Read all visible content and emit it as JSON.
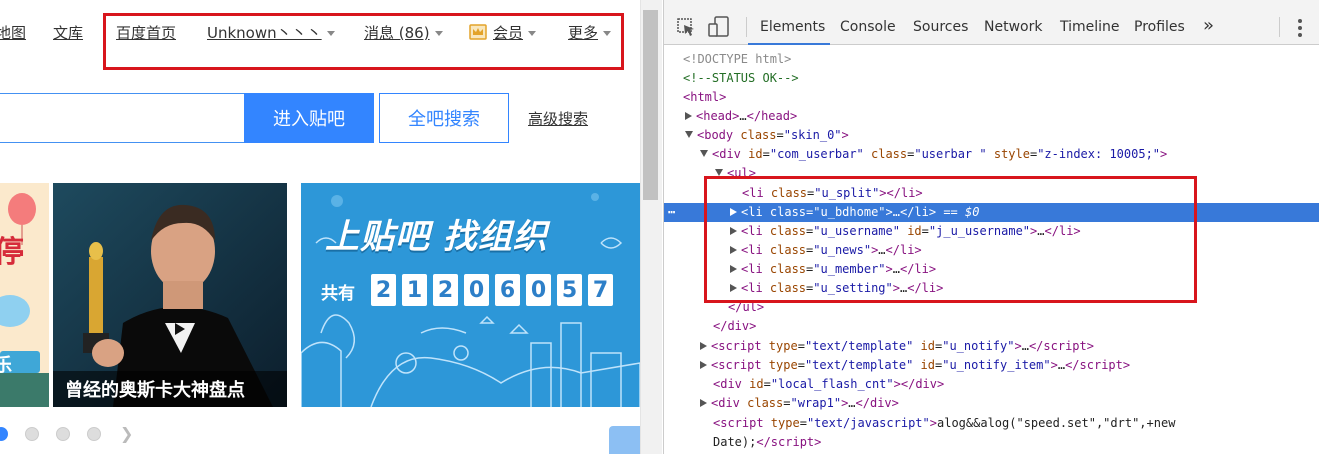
{
  "page": {
    "nav": {
      "sitemap": "地图",
      "wenku": "文库",
      "home": "百度首页",
      "username": "Unknown丶丶丶",
      "messages": "消息 (86)",
      "member": "会员",
      "more": "更多"
    },
    "search": {
      "enter_button": "进入贴吧",
      "all_button": "全吧搜索",
      "advanced_link": "高级搜索",
      "input_value": ""
    },
    "carousel": {
      "left_card_chars": [
        "停",
        "乐"
      ],
      "oscar_caption": "曾经的奥斯卡大神盘点",
      "promo_title": "上贴吧 找组织",
      "promo_count_label": "共有",
      "promo_digits": [
        "2",
        "1",
        "2",
        "0",
        "6",
        "0",
        "5",
        "7"
      ],
      "active_dot": 0
    }
  },
  "devtools": {
    "tabs": [
      "Elements",
      "Console",
      "Sources",
      "Network",
      "Timeline",
      "Profiles"
    ],
    "active_tab": "Elements",
    "more_tabs": "»",
    "dom": {
      "l1": "<!DOCTYPE html>",
      "l2": "<!--STATUS OK-->",
      "l3": "<html>",
      "l4_tag": "head",
      "l5_tag": "body",
      "l5_attr": "class",
      "l5_val": "\"skin_0\"",
      "l6_tag": "div",
      "l6_id": "\"com_userbar\"",
      "l6_class": "\"userbar \"",
      "l6_style": "\"z-index: 10005;\"",
      "l7_tag": "ul",
      "li1": "\"u_split\"",
      "li2": "\"u_bdhome\"",
      "li2_suffix": " == $0",
      "li3": "\"u_username\"",
      "li3_id": "\"j_u_username\"",
      "li4": "\"u_news\"",
      "li5": "\"u_member\"",
      "li6": "\"u_setting\"",
      "s1_type": "\"text/template\"",
      "s1_id": "\"u_notify\"",
      "s2_type": "\"text/template\"",
      "s2_id": "\"u_notify_item\"",
      "div_id": "\"local_flash_cnt\"",
      "div_class": "\"wrap1\"",
      "s3_type": "\"text/javascript\"",
      "s3_body": "alog&&alog(\"speed.set\",\"drt\",+new",
      "s3_body2": "Date);"
    }
  },
  "colors": {
    "highlight_red": "#d8151c",
    "baidu_blue": "#3385ff",
    "selection_blue": "#3879d9"
  }
}
